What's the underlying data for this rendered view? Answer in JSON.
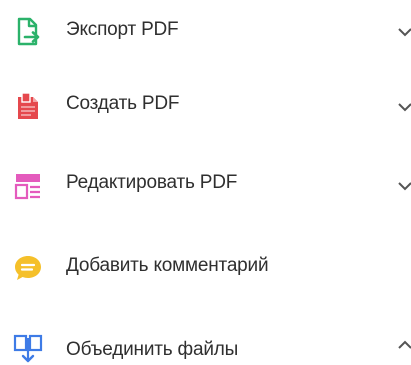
{
  "tools": [
    {
      "label": "Экспорт PDF",
      "icon": "export-pdf-icon",
      "color": "#2bb26a",
      "chevron": "down"
    },
    {
      "label": "Создать PDF",
      "icon": "create-pdf-icon",
      "color": "#e5484d",
      "chevron": "down"
    },
    {
      "label": "Редактировать PDF",
      "icon": "edit-pdf-icon",
      "color": "#e45bbd",
      "chevron": "down"
    },
    {
      "label": "Добавить комментарий",
      "icon": "comment-icon",
      "color": "#f5c02a",
      "chevron": null
    },
    {
      "label": "Объединить файлы",
      "icon": "combine-files-icon",
      "color": "#3e7be6",
      "chevron": "up"
    }
  ]
}
